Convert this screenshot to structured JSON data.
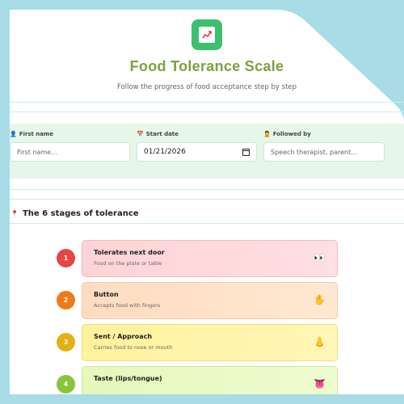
{
  "header": {
    "logo_icon": "chart-increasing-icon",
    "title": "Food Tolerance Scale",
    "subtitle": "Follow the progress of food acceptance step by step"
  },
  "form": {
    "first_name": {
      "label": "First name",
      "placeholder": "First name...",
      "icon": "person-icon"
    },
    "start_date": {
      "label": "Start date",
      "value": "01/21/2026",
      "icon": "calendar-icon"
    },
    "followed_by": {
      "label": "Followed by",
      "placeholder": "Speech therapist, parent...",
      "icon": "person-icon"
    }
  },
  "stages_section": {
    "title": "The 6 stages of tolerance",
    "stages": [
      {
        "num": "1",
        "title": "Tolerates next door",
        "desc": "Food on the plate or table",
        "emoji": "👀",
        "color": "#e64545",
        "bg": "#ffd6d9"
      },
      {
        "num": "2",
        "title": "Button",
        "desc": "Accepts food with fingers",
        "emoji": "✋",
        "color": "#f07a1a",
        "bg": "#ffe0c4"
      },
      {
        "num": "3",
        "title": "Sent / Approach",
        "desc": "Carries food to nose or mouth",
        "emoji": "👃",
        "color": "#e2b114",
        "bg": "#fff4a8"
      },
      {
        "num": "4",
        "title": "Taste (lips/tongue)",
        "desc": "",
        "emoji": "👅",
        "color": "#8bc43a",
        "bg": "#e8f8c4"
      }
    ]
  }
}
